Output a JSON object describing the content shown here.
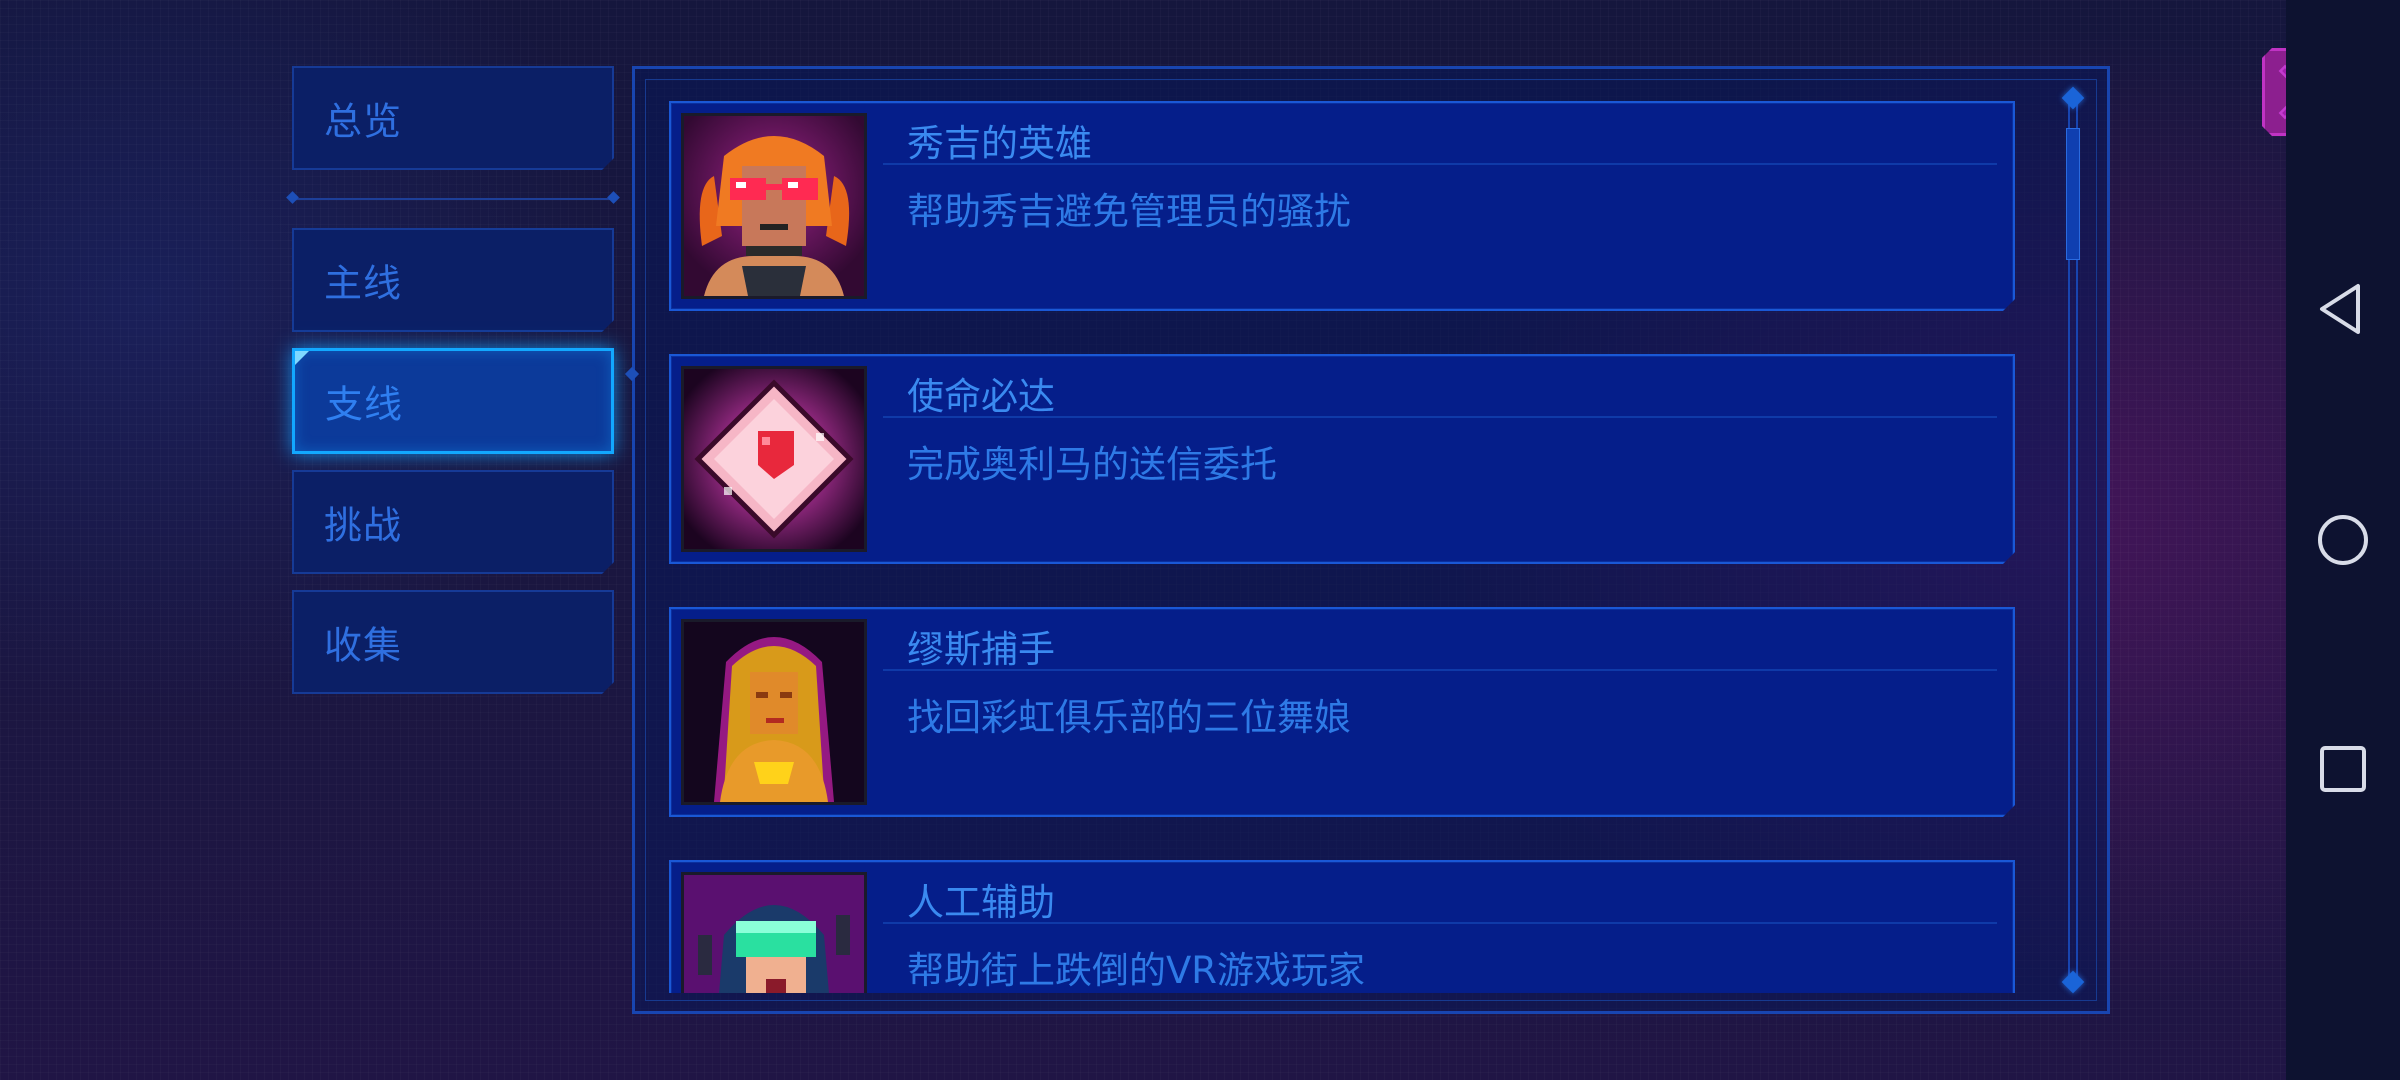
{
  "tabs": [
    {
      "label": "总览",
      "active": false
    },
    {
      "label": "主线",
      "active": false
    },
    {
      "label": "支线",
      "active": true
    },
    {
      "label": "挑战",
      "active": false
    },
    {
      "label": "收集",
      "active": false
    }
  ],
  "quests": [
    {
      "title": "秀吉的英雄",
      "desc": "帮助秀吉避免管理员的骚扰",
      "icon": "girl-with-heart-glasses-portrait"
    },
    {
      "title": "使命必达",
      "desc": "完成奥利马的送信委托",
      "icon": "pink-love-letter-envelope"
    },
    {
      "title": "缪斯捕手",
      "desc": "找回彩虹俱乐部的三位舞娘",
      "icon": "blonde-dancer-portrait"
    },
    {
      "title": "人工辅助",
      "desc": "帮助街上跌倒的VR游戏玩家",
      "icon": "vr-headset-gamer-portrait"
    }
  ],
  "close_button": {
    "icon": "close-x-icon"
  },
  "system_nav": {
    "back": "back-triangle-icon",
    "home": "home-circle-icon",
    "recents": "recents-square-icon"
  },
  "colors": {
    "accent_blue": "#12a8ff",
    "card_bg": "#051e8a",
    "text_blue": "#3a8af0",
    "close_magenta": "#8c1f8f"
  }
}
